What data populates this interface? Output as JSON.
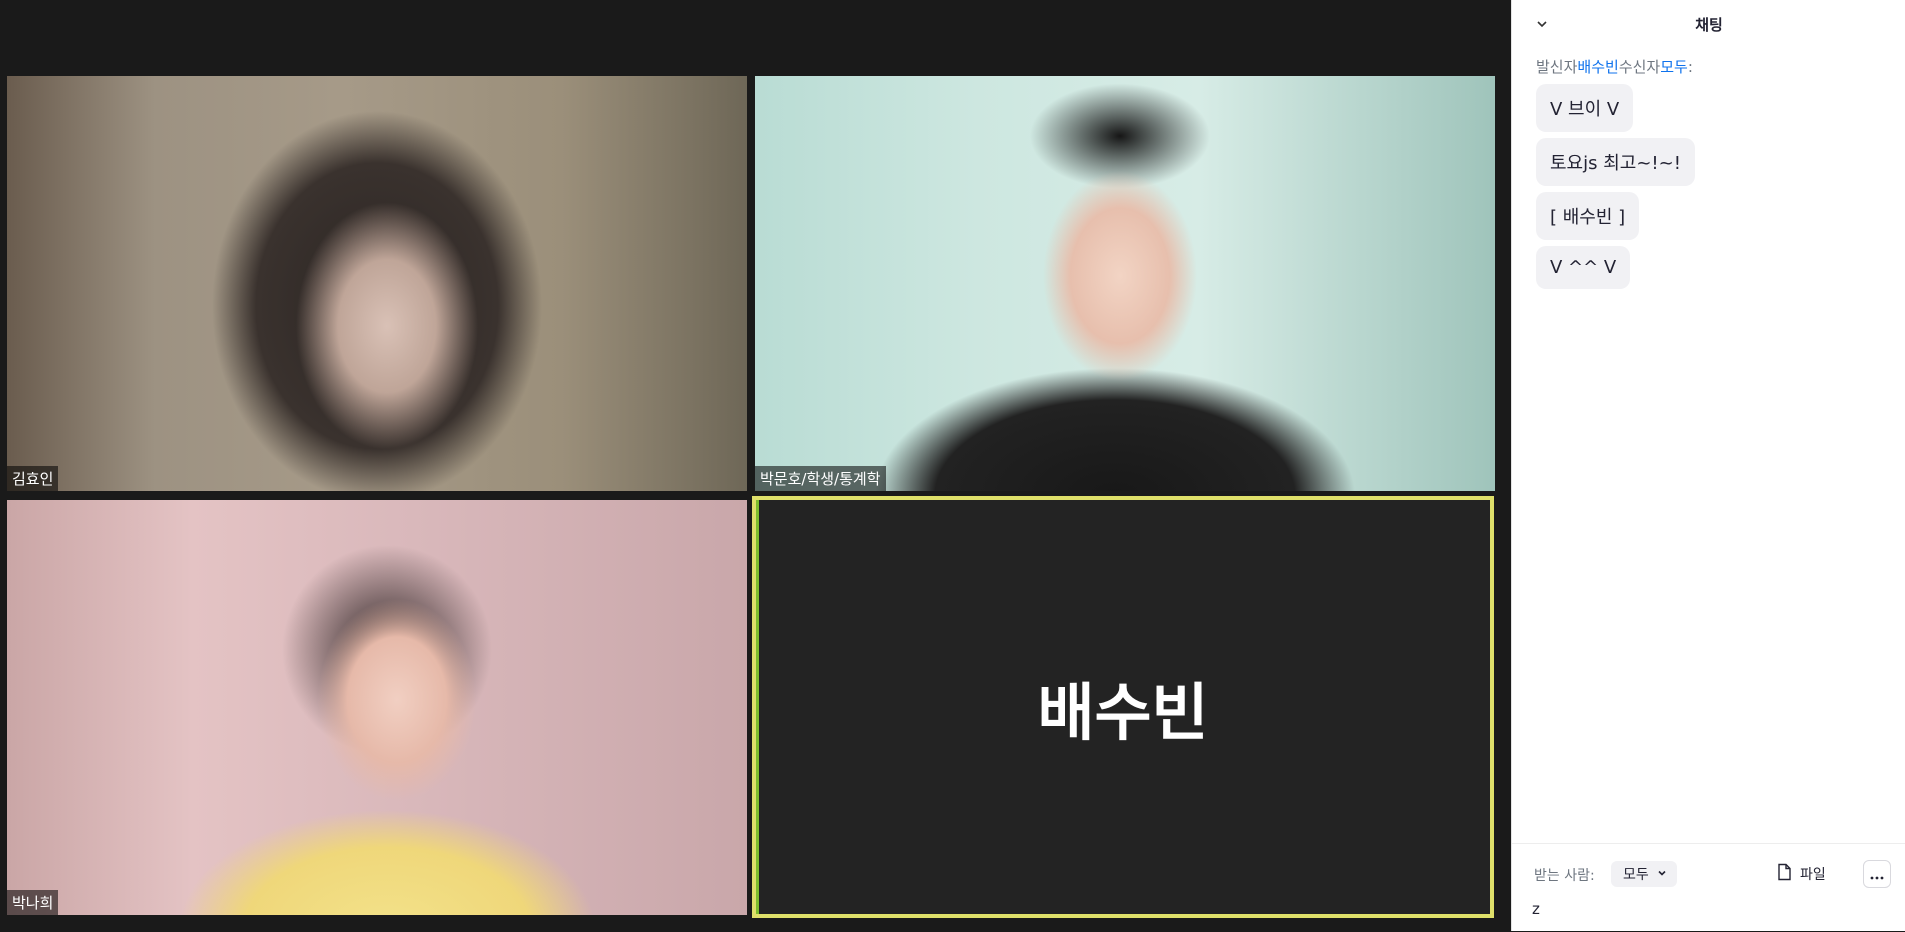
{
  "video_tiles": [
    {
      "name": "김효인"
    },
    {
      "name": "박문호/학생/통계학"
    },
    {
      "name": "박나희"
    },
    {
      "name": "배수빈",
      "active_speaker": true
    }
  ],
  "chat": {
    "title": "채팅",
    "sender_prefix": "발신자",
    "sender_name": "배수빈",
    "recipient_prefix": "수신자",
    "recipient_name": "모두",
    "recipient_suffix": ":",
    "messages": [
      "V 브이 V",
      "토요js 최고~!~!",
      "[ 배수빈 ]",
      "V ^^ V"
    ],
    "footer": {
      "to_label": "받는 사람:",
      "to_value": "모두",
      "file_label": "파일",
      "input_value": "z"
    }
  },
  "colors": {
    "accent_blue": "#0e72ed",
    "active_border": "#dfe06a",
    "bubble_bg": "#f1f1f4"
  },
  "icons": [
    "chevron-down-icon",
    "file-icon",
    "more-icon"
  ]
}
